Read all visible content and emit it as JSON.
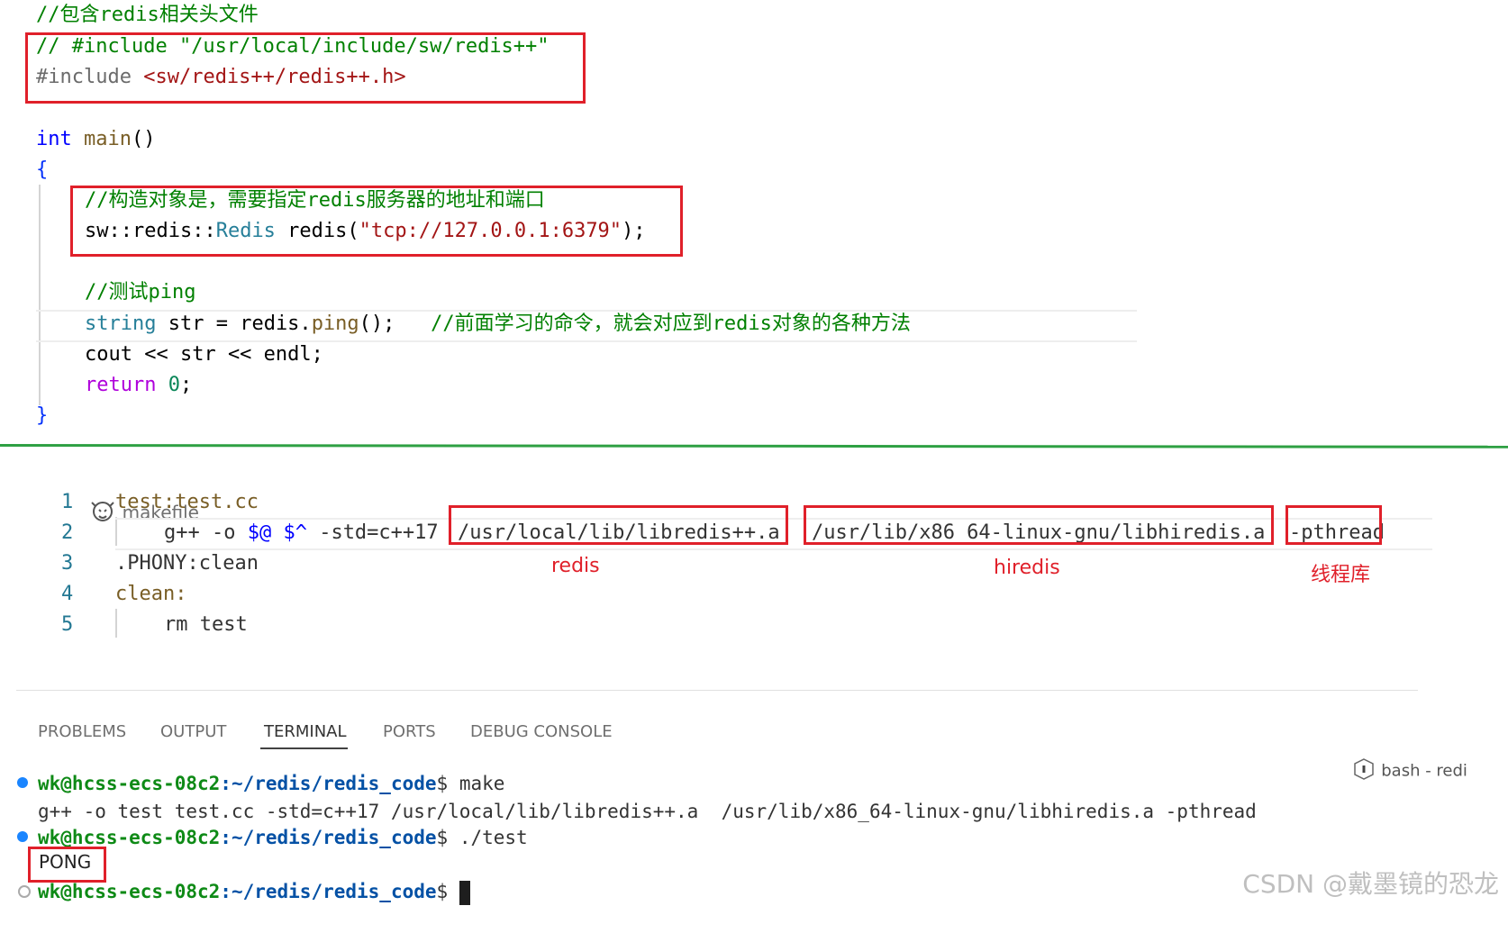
{
  "code": {
    "line1_comment": "//包含redis相关头文件",
    "line2_comment": "// #include \"/usr/local/include/sw/redis++\"",
    "line3_include_kw": "#include ",
    "line3_include_path": "<sw/redis++/redis++.h>",
    "main_type": "int",
    "main_name": "main",
    "main_parens": "()",
    "open_brace": "{",
    "construct_comment": "//构造对象是，需要指定redis服务器的地址和端口",
    "construct_ns": "sw::redis::",
    "construct_type": "Redis",
    "construct_var": " redis(",
    "construct_str": "\"tcp://127.0.0.1:6379\"",
    "construct_end": ");",
    "ping_comment": "//测试ping",
    "string_type": "string",
    "string_rest": " str = ",
    "string_call_obj": "redis.",
    "string_call_fn": "ping",
    "string_call_end": "();",
    "string_comment": "//前面学习的命令，就会对应到redis对象的各种方法",
    "cout_line": "cout << str << endl;",
    "return_kw": "return",
    "return_val": "0",
    "return_end": ";",
    "close_brace": "}"
  },
  "makefile": {
    "filename": "makefile",
    "line_numbers": [
      "1",
      "2",
      "3",
      "4",
      "5"
    ],
    "line1": "test:test.cc",
    "line2_cmd": "g++ -o ",
    "line2_vars": "$@ $^",
    "line2_std": " -std=c++17 ",
    "line2_redis": "/usr/local/lib/libredis++.a",
    "line2_hiredis": "/usr/lib/x86_64-linux-gnu/libhiredis.a",
    "line2_pthread": "-pthread",
    "line3": ".PHONY:clean",
    "line4": "clean:",
    "line5": "rm test",
    "label_redis": "redis",
    "label_hiredis": "hiredis",
    "label_pthread": "线程库"
  },
  "panel": {
    "tabs": [
      "PROBLEMS",
      "OUTPUT",
      "TERMINAL",
      "PORTS",
      "DEBUG CONSOLE"
    ],
    "active_tab": "TERMINAL",
    "terminal_name": "bash - redi"
  },
  "terminal": {
    "user_host": "wk@hcss-ecs-08c2",
    "path": ":~/redis/redis_code",
    "prompt_sign": "$",
    "cmd1": " make",
    "output1": "g++ -o test test.cc -std=c++17 /usr/local/lib/libredis++.a  /usr/lib/x86_64-linux-gnu/libhiredis.a -pthread",
    "cmd2": " ./test",
    "output2": "PONG",
    "cmd3": " "
  },
  "watermark": "CSDN @戴墨镜的恐龙",
  "colors": {
    "highlight_box": "#e0202a",
    "divider": "#2ea043",
    "comment": "#008000",
    "keyword": "#0000ff",
    "string": "#a31515"
  }
}
